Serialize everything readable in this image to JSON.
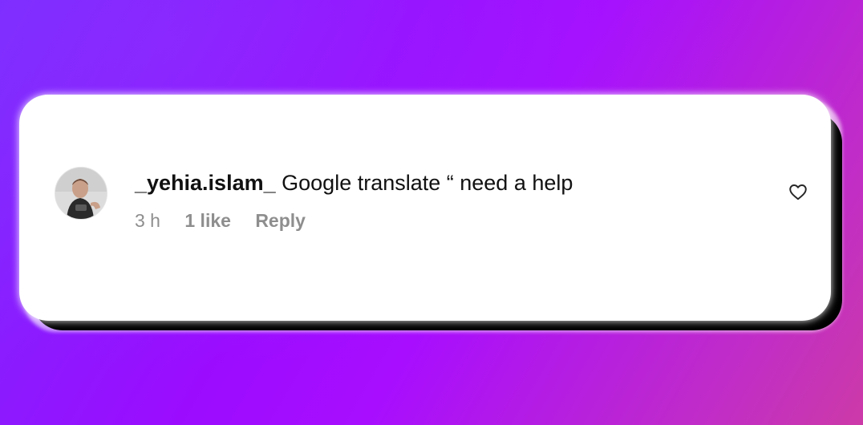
{
  "comment": {
    "username": "_yehia.islam_",
    "text": "Google translate “ need a help",
    "time": "3 h",
    "likes": "1 like",
    "reply_label": "Reply"
  },
  "icons": {
    "like": "heart-outline-icon",
    "avatar": "profile-avatar"
  },
  "colors": {
    "text": "#111111",
    "meta": "#8e8e8e",
    "card": "#ffffff"
  }
}
